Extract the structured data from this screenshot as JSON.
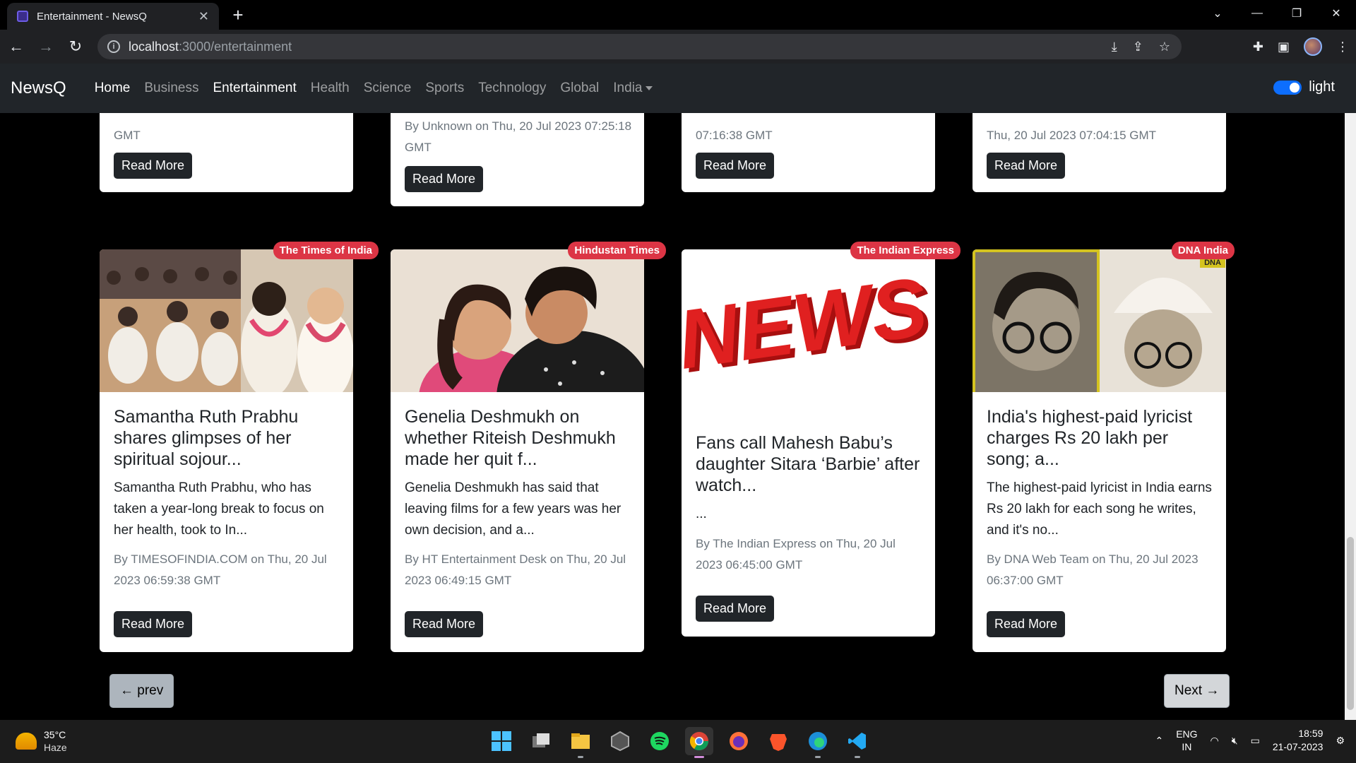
{
  "browser": {
    "tab_title": "Entertainment - NewsQ",
    "url_host": "localhost",
    "url_path": ":3000/entertainment"
  },
  "nav": {
    "brand": "NewsQ",
    "links": [
      "Home",
      "Business",
      "Entertainment",
      "Health",
      "Science",
      "Sports",
      "Technology",
      "Global",
      "India"
    ],
    "theme_label": "light"
  },
  "top_cards": [
    {
      "meta": "GMT",
      "button": "Read More"
    },
    {
      "meta": "By Unknown on Thu, 20 Jul 2023 07:25:18 GMT",
      "button": "Read More"
    },
    {
      "meta": "07:16:38 GMT",
      "button": "Read More"
    },
    {
      "meta": "Thu, 20 Jul 2023 07:04:15 GMT",
      "button": "Read More"
    }
  ],
  "cards": [
    {
      "source": "The Times of India",
      "title": "Samantha Ruth Prabhu shares glimpses of her spiritual sojour...",
      "description": "Samantha Ruth Prabhu, who has taken a year-long break to focus on her health, took to In...",
      "meta": "By TIMESOFINDIA.COM on Thu, 20 Jul 2023 06:59:38 GMT",
      "button": "Read More"
    },
    {
      "source": "Hindustan Times",
      "title": "Genelia Deshmukh on whether Riteish Deshmukh made her quit f...",
      "description": "Genelia Deshmukh has said that leaving films for a few years was her own decision, and a...",
      "meta": "By HT Entertainment Desk on Thu, 20 Jul 2023 06:49:15 GMT",
      "button": "Read More"
    },
    {
      "source": "The Indian Express",
      "image_text": "NEWS",
      "title": "Fans call Mahesh Babu’s daughter Sitara ‘Barbie’ after watch...",
      "description": "...",
      "meta": "By The Indian Express on Thu, 20 Jul 2023 06:45:00 GMT",
      "button": "Read More"
    },
    {
      "source": "DNA India",
      "image_text": "DNA",
      "title": "India's highest-paid lyricist charges Rs 20 lakh per song; a...",
      "description": "The highest-paid lyricist in India earns Rs 20 lakh for each song he writes, and it's no...",
      "meta": "By DNA Web Team on Thu, 20 Jul 2023 06:37:00 GMT",
      "button": "Read More"
    }
  ],
  "pagination": {
    "prev": "← prev",
    "next": "Next →"
  },
  "taskbar": {
    "temp": "35°C",
    "weather": "Haze",
    "lang1": "ENG",
    "lang2": "IN",
    "time": "18:59",
    "date": "21-07-2023"
  },
  "colors": {
    "badge": "#dc3545",
    "navbar": "#212529",
    "toggle": "#0d6efd"
  }
}
